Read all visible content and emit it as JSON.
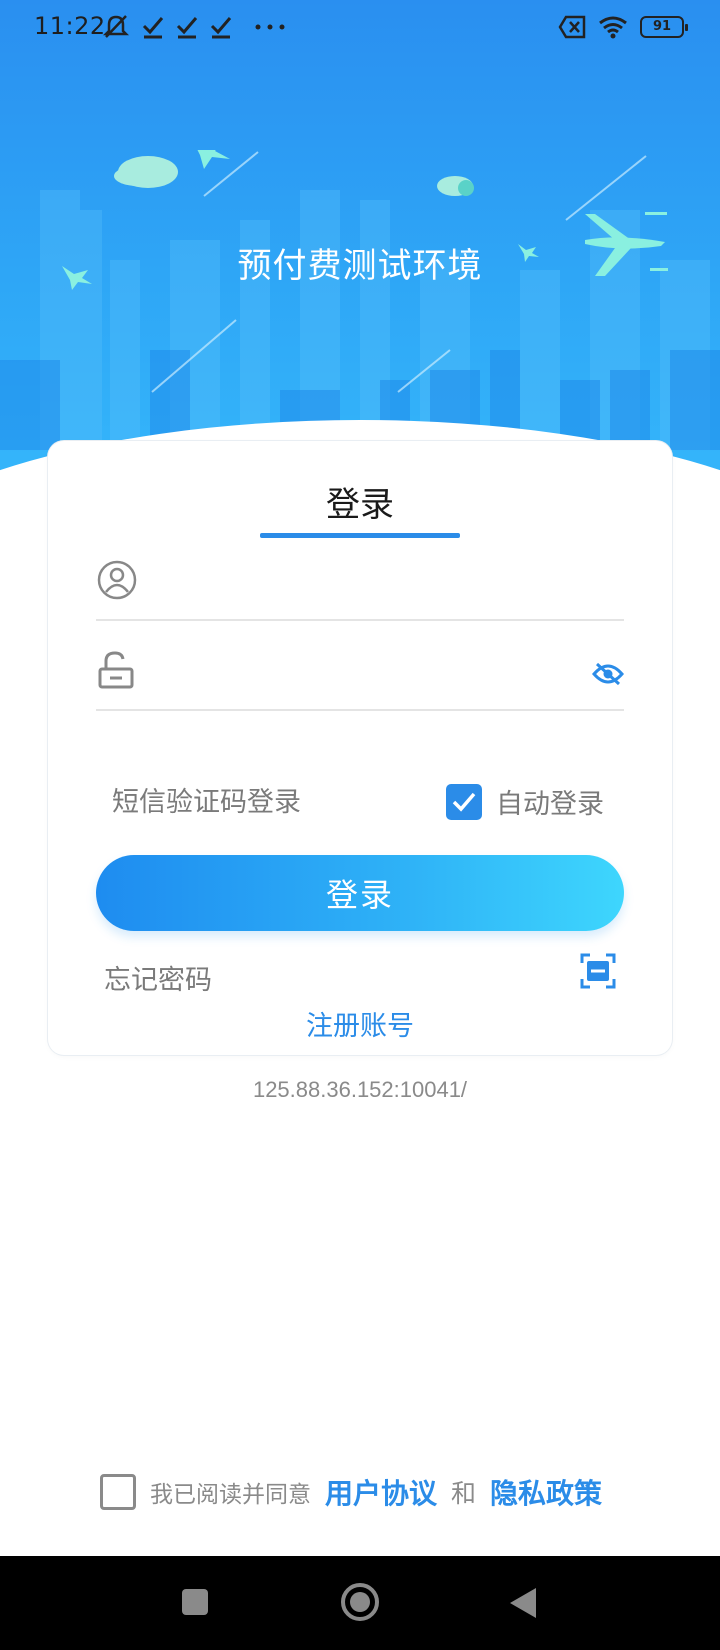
{
  "status_bar": {
    "time": "11:22",
    "battery_level": "91",
    "left_icons": [
      "mute-icon",
      "check-icon",
      "check-icon",
      "check-icon",
      "more-dots-icon"
    ],
    "right_icons": [
      "sim-blocked-icon",
      "wifi-icon",
      "battery-icon"
    ]
  },
  "header": {
    "title": "预付费测试环境"
  },
  "login_card": {
    "tab_title": "登录",
    "username": {
      "value": "",
      "placeholder": ""
    },
    "password": {
      "value": "",
      "placeholder": ""
    },
    "sms_login_label": "短信验证码登录",
    "auto_login": {
      "label": "自动登录",
      "checked": true
    },
    "login_button_label": "登录",
    "forgot_password_label": "忘记密码",
    "register_label": "注册账号"
  },
  "server_url": "125.88.36.152:10041/",
  "agreement": {
    "checked": false,
    "prefix": "我已阅读并同意",
    "user_agreement": "用户协议",
    "conjunction": "和",
    "privacy_policy": "隐私政策"
  },
  "colors": {
    "primary": "#2b8ce8",
    "header_top": "#2a8ff0",
    "header_bottom": "#35b7fb",
    "button_start": "#1e8cf0",
    "button_end": "#3ed6fd"
  }
}
